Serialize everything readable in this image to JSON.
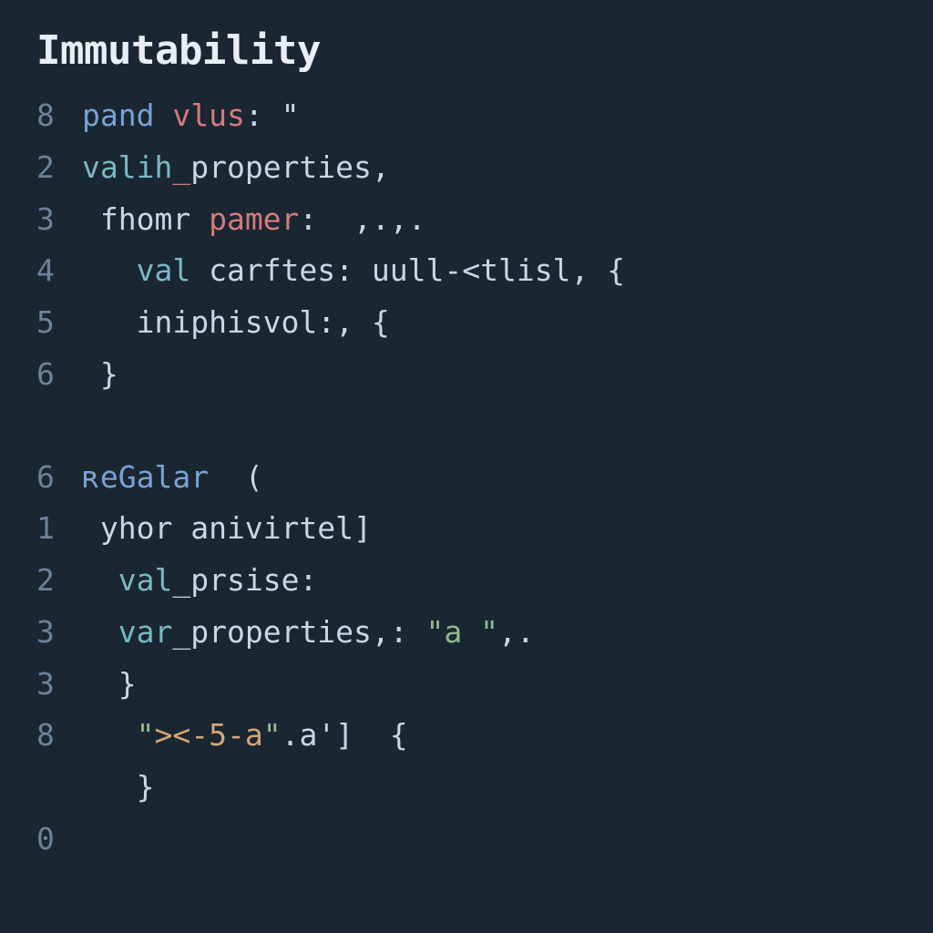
{
  "title": "Immutability",
  "block1": {
    "lines": [
      {
        "num": "8",
        "tokens": [
          {
            "t": "pand",
            "c": "kw-blue"
          },
          {
            "t": " ",
            "c": "code"
          },
          {
            "t": "vlus",
            "c": "kw-red"
          },
          {
            "t": ": \"",
            "c": "code"
          }
        ]
      },
      {
        "num": "2",
        "tokens": [
          {
            "t": "valih",
            "c": "kw-teal"
          },
          {
            "t": "_",
            "c": "kw-red"
          },
          {
            "t": "properties,",
            "c": "code"
          }
        ]
      },
      {
        "num": "3",
        "tokens": [
          {
            "t": " fhomr ",
            "c": "code"
          },
          {
            "t": "pamer",
            "c": "kw-red"
          },
          {
            "t": ":  ,.,.",
            "c": "code"
          }
        ]
      },
      {
        "num": "4",
        "tokens": [
          {
            "t": "   ",
            "c": "code"
          },
          {
            "t": "val",
            "c": "kw-teal"
          },
          {
            "t": " carftes: uull-<tlisl, {",
            "c": "code"
          }
        ]
      },
      {
        "num": "5",
        "tokens": [
          {
            "t": "   iniphisvol:, {",
            "c": "code"
          }
        ]
      },
      {
        "num": "6",
        "tokens": [
          {
            "t": " }",
            "c": "code"
          }
        ]
      }
    ]
  },
  "block2": {
    "lines": [
      {
        "num": "6",
        "tokens": [
          {
            "t": "ʀeGalar",
            "c": "kw-blue"
          },
          {
            "t": "  (",
            "c": "code"
          }
        ]
      },
      {
        "num": "1",
        "tokens": [
          {
            "t": " yhor anivirtel]",
            "c": "code"
          }
        ]
      },
      {
        "num": "2",
        "tokens": [
          {
            "t": "  ",
            "c": "code"
          },
          {
            "t": "val",
            "c": "kw-teal"
          },
          {
            "t": "_",
            "c": "code"
          },
          {
            "t": "prsise:",
            "c": "code"
          }
        ]
      },
      {
        "num": "3",
        "tokens": [
          {
            "t": "  ",
            "c": "code"
          },
          {
            "t": "var",
            "c": "kw-teal"
          },
          {
            "t": "_",
            "c": "code"
          },
          {
            "t": "properties,: ",
            "c": "code"
          },
          {
            "t": "\"a \"",
            "c": "str-green"
          },
          {
            "t": ",.",
            "c": "code"
          }
        ]
      },
      {
        "num": "3",
        "tokens": [
          {
            "t": "  }",
            "c": "code"
          }
        ]
      },
      {
        "num": "8",
        "tokens": [
          {
            "t": "   ",
            "c": "code"
          },
          {
            "t": "\"",
            "c": "str-green"
          },
          {
            "t": "><-5-a",
            "c": "str-orange"
          },
          {
            "t": "\"",
            "c": "str-green"
          },
          {
            "t": ".a']",
            "c": "code"
          },
          {
            "t": "  {",
            "c": "code"
          }
        ]
      },
      {
        "num": " ",
        "tokens": [
          {
            "t": "   }",
            "c": "code"
          }
        ]
      },
      {
        "num": "0",
        "tokens": [
          {
            "t": "",
            "c": "code"
          }
        ]
      }
    ]
  }
}
